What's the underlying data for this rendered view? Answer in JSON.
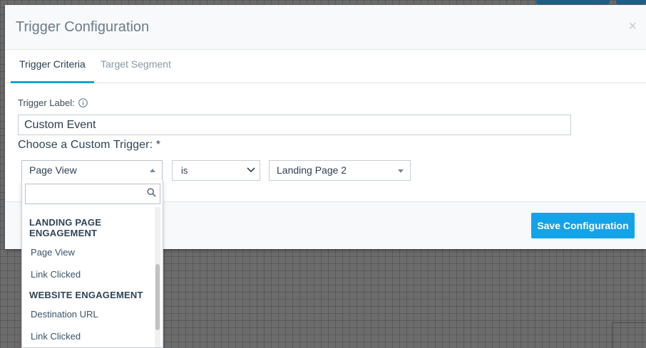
{
  "modal": {
    "title": "Trigger Configuration",
    "close_glyph": "×"
  },
  "tabs": [
    {
      "label": "Trigger Criteria",
      "active": true
    },
    {
      "label": "Target Segment",
      "active": false
    }
  ],
  "form": {
    "trigger_label": "Trigger Label:",
    "trigger_value": "Custom Event",
    "choose_label": "Choose a Custom Trigger: *"
  },
  "selects": {
    "trigger": "Page View",
    "operator": "is",
    "page": "Landing Page 2"
  },
  "dropdown": {
    "search_value": "",
    "groups": [
      {
        "label_line1": "LANDING PAGE",
        "label_line2": "ENGAGEMENT",
        "items": [
          "Page View",
          "Link Clicked"
        ]
      },
      {
        "label_line1": "WEBSITE ENGAGEMENT",
        "items": [
          "Destination URL",
          "Link Clicked"
        ]
      }
    ]
  },
  "footer": {
    "save_label": "Save Configuration"
  },
  "colors": {
    "accent": "#13a3e9",
    "tab_underline": "#13a3d8"
  },
  "icons": [
    "close-icon",
    "info-icon",
    "caret-up-icon",
    "chevron-down-icon",
    "caret-down-icon",
    "search-icon"
  ]
}
